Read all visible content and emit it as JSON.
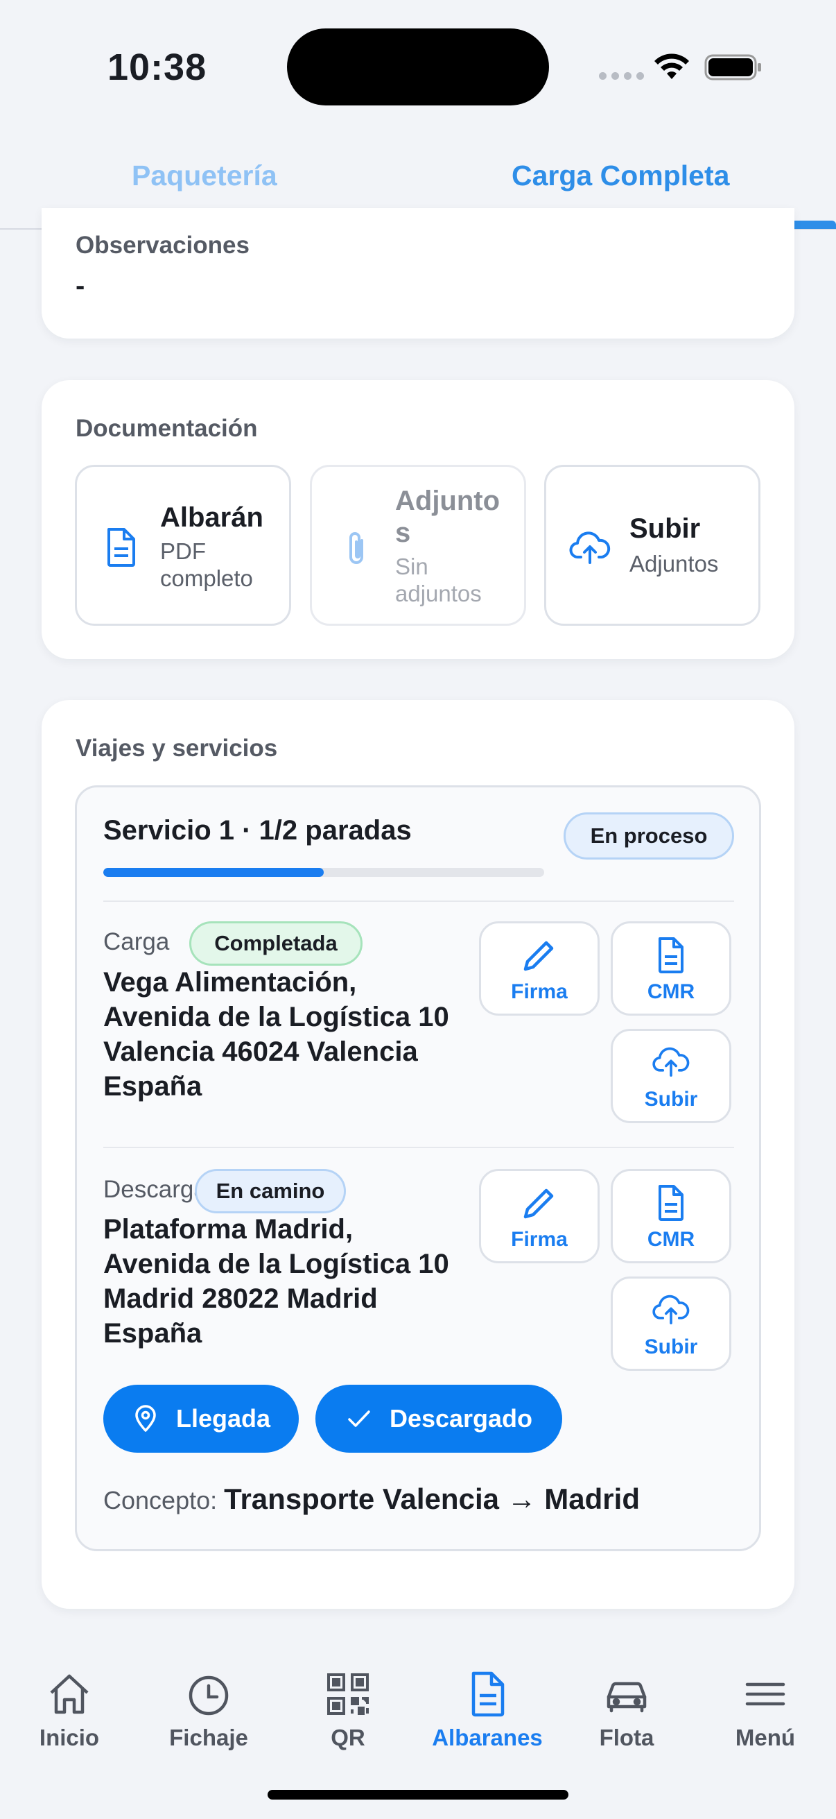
{
  "status_bar": {
    "time": "10:38"
  },
  "tabs": [
    {
      "label": "Paquetería",
      "active": false
    },
    {
      "label": "Carga Completa",
      "active": true
    }
  ],
  "observaciones": {
    "label": "Observaciones",
    "value": "-"
  },
  "documentacion": {
    "label": "Documentación",
    "tiles": [
      {
        "title": "Albarán",
        "subtitle": "PDF completo",
        "icon": "document-icon",
        "enabled": true
      },
      {
        "title": "Adjuntos",
        "subtitle": "Sin adjuntos",
        "icon": "paperclip-icon",
        "enabled": false
      },
      {
        "title": "Subir",
        "subtitle": "Adjuntos",
        "icon": "cloud-upload-icon",
        "enabled": true
      }
    ]
  },
  "viajes": {
    "label": "Viajes y servicios",
    "service": {
      "title": "Servicio 1 · 1/2 paradas",
      "status": "En proceso",
      "progress": 0.5,
      "stops": [
        {
          "type": "Carga",
          "status": "Completada",
          "address": "Vega Alimentación, Avenida de la Logística 10 Valencia 46024 Valencia España",
          "actions": {
            "firma": "Firma",
            "cmr": "CMR",
            "subir": "Subir"
          }
        },
        {
          "type": "Descarga",
          "status": "En camino",
          "address": "Plataforma Madrid, Avenida de la Logística 10 Madrid 28022 Madrid España",
          "actions": {
            "firma": "Firma",
            "cmr": "CMR",
            "subir": "Subir"
          }
        }
      ],
      "buttons": {
        "llegada": "Llegada",
        "descargado": "Descargado"
      },
      "concept_label": "Concepto:",
      "concept_value": "Transporte Valencia → Madrid"
    }
  },
  "bottom_nav": [
    {
      "label": "Inicio",
      "icon": "home-icon",
      "active": false
    },
    {
      "label": "Fichaje",
      "icon": "clock-icon",
      "active": false
    },
    {
      "label": "QR",
      "icon": "qr-code-icon",
      "active": false
    },
    {
      "label": "Albaranes",
      "icon": "document-icon",
      "active": true
    },
    {
      "label": "Flota",
      "icon": "car-icon",
      "active": false
    },
    {
      "label": "Menú",
      "icon": "menu-icon",
      "active": false
    }
  ],
  "colors": {
    "accent": "#1a7df0",
    "tab_active": "#2e8ee8",
    "tab_inactive": "#8fc2f5",
    "success_bg": "#e3f7ea",
    "info_bg": "#e6f0fd"
  }
}
